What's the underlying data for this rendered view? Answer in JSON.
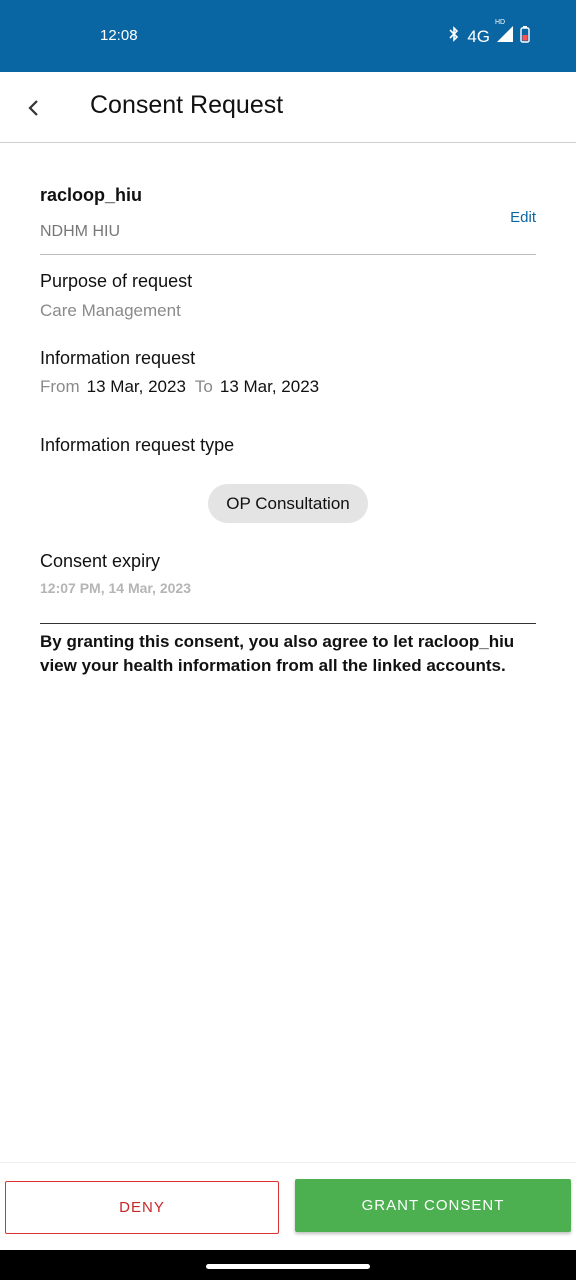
{
  "status": {
    "time": "12:08",
    "network": "4G",
    "hd": "HD"
  },
  "header": {
    "title": "Consent Request"
  },
  "requester": {
    "name": "racloop_hiu",
    "type": "NDHM HIU",
    "edit_label": "Edit"
  },
  "purpose": {
    "label": "Purpose of request",
    "value": "Care Management"
  },
  "info_request": {
    "label": "Information request",
    "from_label": "From",
    "from": "13 Mar, 2023",
    "to_label": "To",
    "to": "13 Mar, 2023"
  },
  "info_type": {
    "label": "Information request type",
    "chip": "OP Consultation"
  },
  "expiry": {
    "label": "Consent expiry",
    "value": "12:07 PM, 14 Mar, 2023"
  },
  "agreement_text": "By granting this consent, you also agree to let racloop_hiu view your health information from all the linked accounts.",
  "actions": {
    "deny": "DENY",
    "grant": "GRANT CONSENT"
  },
  "icons": [
    "back-arrow-icon",
    "bluetooth-icon",
    "signal-icon",
    "battery-icon"
  ],
  "colors": {
    "primary": "#0a66a3",
    "deny": "#c62828",
    "grant": "#4caf50"
  }
}
